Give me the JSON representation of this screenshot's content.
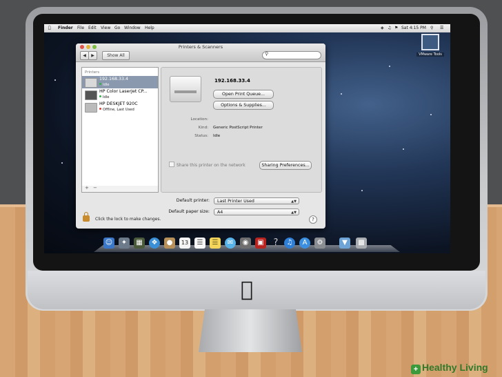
{
  "menubar": {
    "items": [
      "Finder",
      "File",
      "Edit",
      "View",
      "Go",
      "Window",
      "Help"
    ],
    "clock": "Sat 4:15 PM"
  },
  "desktop": {
    "vmware_label": "VMware Tools"
  },
  "window": {
    "title": "Printers & Scanners",
    "show_all": "Show All",
    "search_placeholder": "",
    "printers_header": "Printers",
    "printers": [
      {
        "name": "192.168.33.4",
        "status": "Idle",
        "status_color": "#36b24a",
        "selected": true
      },
      {
        "name": "HP Color LaserJet CP...",
        "status": "Idle",
        "status_color": "#36b24a",
        "selected": false
      },
      {
        "name": "HP DESKJET 920C",
        "status": "Offline, Last Used",
        "status_color": "#d83a33",
        "selected": false
      }
    ],
    "add_symbol": "+",
    "remove_symbol": "−",
    "detail": {
      "printer_name": "192.168.33.4",
      "open_queue": "Open Print Queue...",
      "options_supplies": "Options & Supplies...",
      "location_label": "Location:",
      "location_value": "",
      "kind_label": "Kind:",
      "kind_value": "Generic PostScript Printer",
      "status_label": "Status:",
      "status_value": "Idle",
      "share_text": "Share this printer on the network",
      "sharing_prefs": "Sharing Preferences..."
    },
    "default_printer_label": "Default printer:",
    "default_printer_value": "Last Printer Used",
    "default_paper_label": "Default paper size:",
    "default_paper_value": "A4",
    "lock_text": "Click the lock to make changes.",
    "help_symbol": "?"
  },
  "dock": {
    "items": [
      "finder-icon",
      "launchpad-icon",
      "mission-control-icon",
      "safari-icon",
      "contacts-icon",
      "calendar-icon",
      "reminders-icon",
      "notes-icon",
      "messages-icon",
      "facetime-icon",
      "photo-booth-icon",
      "itunes-icon",
      "app-store-icon",
      "system-preferences-icon",
      "downloads-icon",
      "trash-icon"
    ],
    "calendar_day": "13"
  },
  "watermark": "Healthy Living"
}
